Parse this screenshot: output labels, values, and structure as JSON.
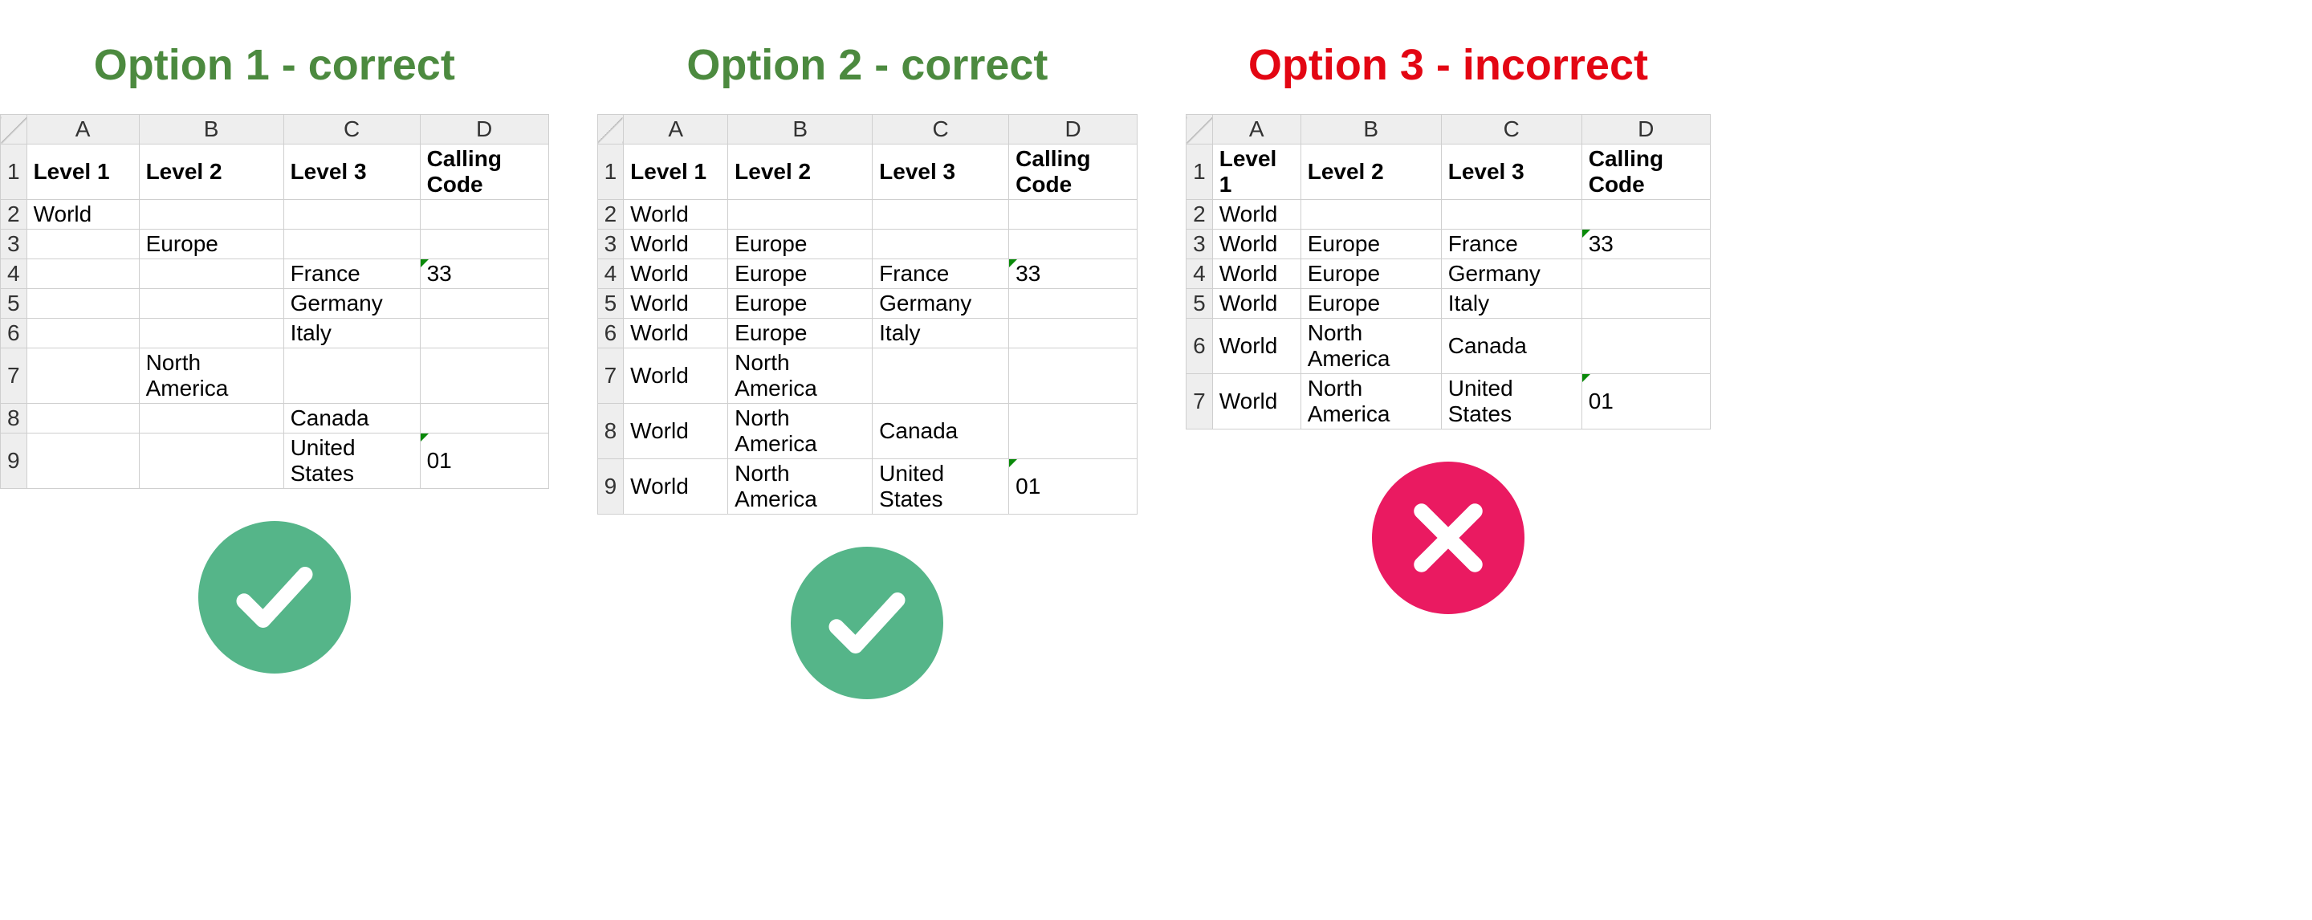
{
  "colors": {
    "green": "#4c8a3f",
    "red": "#e30613",
    "ok_bg": "#55b589",
    "bad_bg": "#ea1a61"
  },
  "columns": [
    "A",
    "B",
    "C",
    "D"
  ],
  "col_widths": {
    "option1": [
      140,
      180,
      170,
      160
    ],
    "option2": [
      130,
      180,
      170,
      160
    ],
    "option3": [
      110,
      175,
      175,
      160
    ]
  },
  "options": [
    {
      "key": "option1",
      "title": "Option 1 - correct",
      "title_class": "title-green",
      "status": "ok",
      "headers": [
        "Level 1",
        "Level 2",
        "Level 3",
        "Calling Code"
      ],
      "rows": [
        [
          "World",
          "",
          "",
          ""
        ],
        [
          "",
          "Europe",
          "",
          ""
        ],
        [
          "",
          "",
          "France",
          {
            "v": "33",
            "flag": true
          }
        ],
        [
          "",
          "",
          "Germany",
          ""
        ],
        [
          "",
          "",
          "Italy",
          ""
        ],
        [
          "",
          "North America",
          "",
          ""
        ],
        [
          "",
          "",
          "Canada",
          ""
        ],
        [
          "",
          "",
          "United States",
          {
            "v": "01",
            "flag": true
          }
        ]
      ]
    },
    {
      "key": "option2",
      "title": "Option 2 - correct",
      "title_class": "title-green",
      "status": "ok",
      "headers": [
        "Level 1",
        "Level 2",
        "Level 3",
        "Calling Code"
      ],
      "rows": [
        [
          "World",
          "",
          "",
          ""
        ],
        [
          "World",
          "Europe",
          "",
          ""
        ],
        [
          "World",
          "Europe",
          "France",
          {
            "v": "33",
            "flag": true
          }
        ],
        [
          "World",
          "Europe",
          "Germany",
          ""
        ],
        [
          "World",
          "Europe",
          "Italy",
          ""
        ],
        [
          "World",
          "North America",
          "",
          ""
        ],
        [
          "World",
          "North America",
          "Canada",
          ""
        ],
        [
          "World",
          "North America",
          "United States",
          {
            "v": "01",
            "flag": true
          }
        ]
      ]
    },
    {
      "key": "option3",
      "title": "Option 3 - incorrect",
      "title_class": "title-red",
      "status": "bad",
      "headers": [
        "Level 1",
        "Level 2",
        "Level 3",
        "Calling Code"
      ],
      "rows": [
        [
          "World",
          "",
          "",
          ""
        ],
        [
          "World",
          "Europe",
          "France",
          {
            "v": "33",
            "flag": true
          }
        ],
        [
          "World",
          "Europe",
          "Germany",
          ""
        ],
        [
          "World",
          "Europe",
          "Italy",
          ""
        ],
        [
          "World",
          "North America",
          "Canada",
          ""
        ],
        [
          "World",
          "North America",
          "United States",
          {
            "v": "01",
            "flag": true
          }
        ]
      ]
    }
  ],
  "chart_data": {
    "type": "table",
    "tables": [
      {
        "name": "Option 1 - correct",
        "columns": [
          "Level 1",
          "Level 2",
          "Level 3",
          "Calling Code"
        ],
        "rows": [
          [
            "World",
            "",
            "",
            ""
          ],
          [
            "",
            "Europe",
            "",
            ""
          ],
          [
            "",
            "",
            "France",
            "33"
          ],
          [
            "",
            "",
            "Germany",
            ""
          ],
          [
            "",
            "",
            "Italy",
            ""
          ],
          [
            "",
            "North America",
            "",
            ""
          ],
          [
            "",
            "",
            "Canada",
            ""
          ],
          [
            "",
            "",
            "United States",
            "01"
          ]
        ]
      },
      {
        "name": "Option 2 - correct",
        "columns": [
          "Level 1",
          "Level 2",
          "Level 3",
          "Calling Code"
        ],
        "rows": [
          [
            "World",
            "",
            "",
            ""
          ],
          [
            "World",
            "Europe",
            "",
            ""
          ],
          [
            "World",
            "Europe",
            "France",
            "33"
          ],
          [
            "World",
            "Europe",
            "Germany",
            ""
          ],
          [
            "World",
            "Europe",
            "Italy",
            ""
          ],
          [
            "World",
            "North America",
            "",
            ""
          ],
          [
            "World",
            "North America",
            "Canada",
            ""
          ],
          [
            "World",
            "North America",
            "United States",
            "01"
          ]
        ]
      },
      {
        "name": "Option 3 - incorrect",
        "columns": [
          "Level 1",
          "Level 2",
          "Level 3",
          "Calling Code"
        ],
        "rows": [
          [
            "World",
            "",
            "",
            ""
          ],
          [
            "World",
            "Europe",
            "France",
            "33"
          ],
          [
            "World",
            "Europe",
            "Germany",
            ""
          ],
          [
            "World",
            "Europe",
            "Italy",
            ""
          ],
          [
            "World",
            "North America",
            "Canada",
            ""
          ],
          [
            "World",
            "North America",
            "United States",
            "01"
          ]
        ]
      }
    ]
  }
}
